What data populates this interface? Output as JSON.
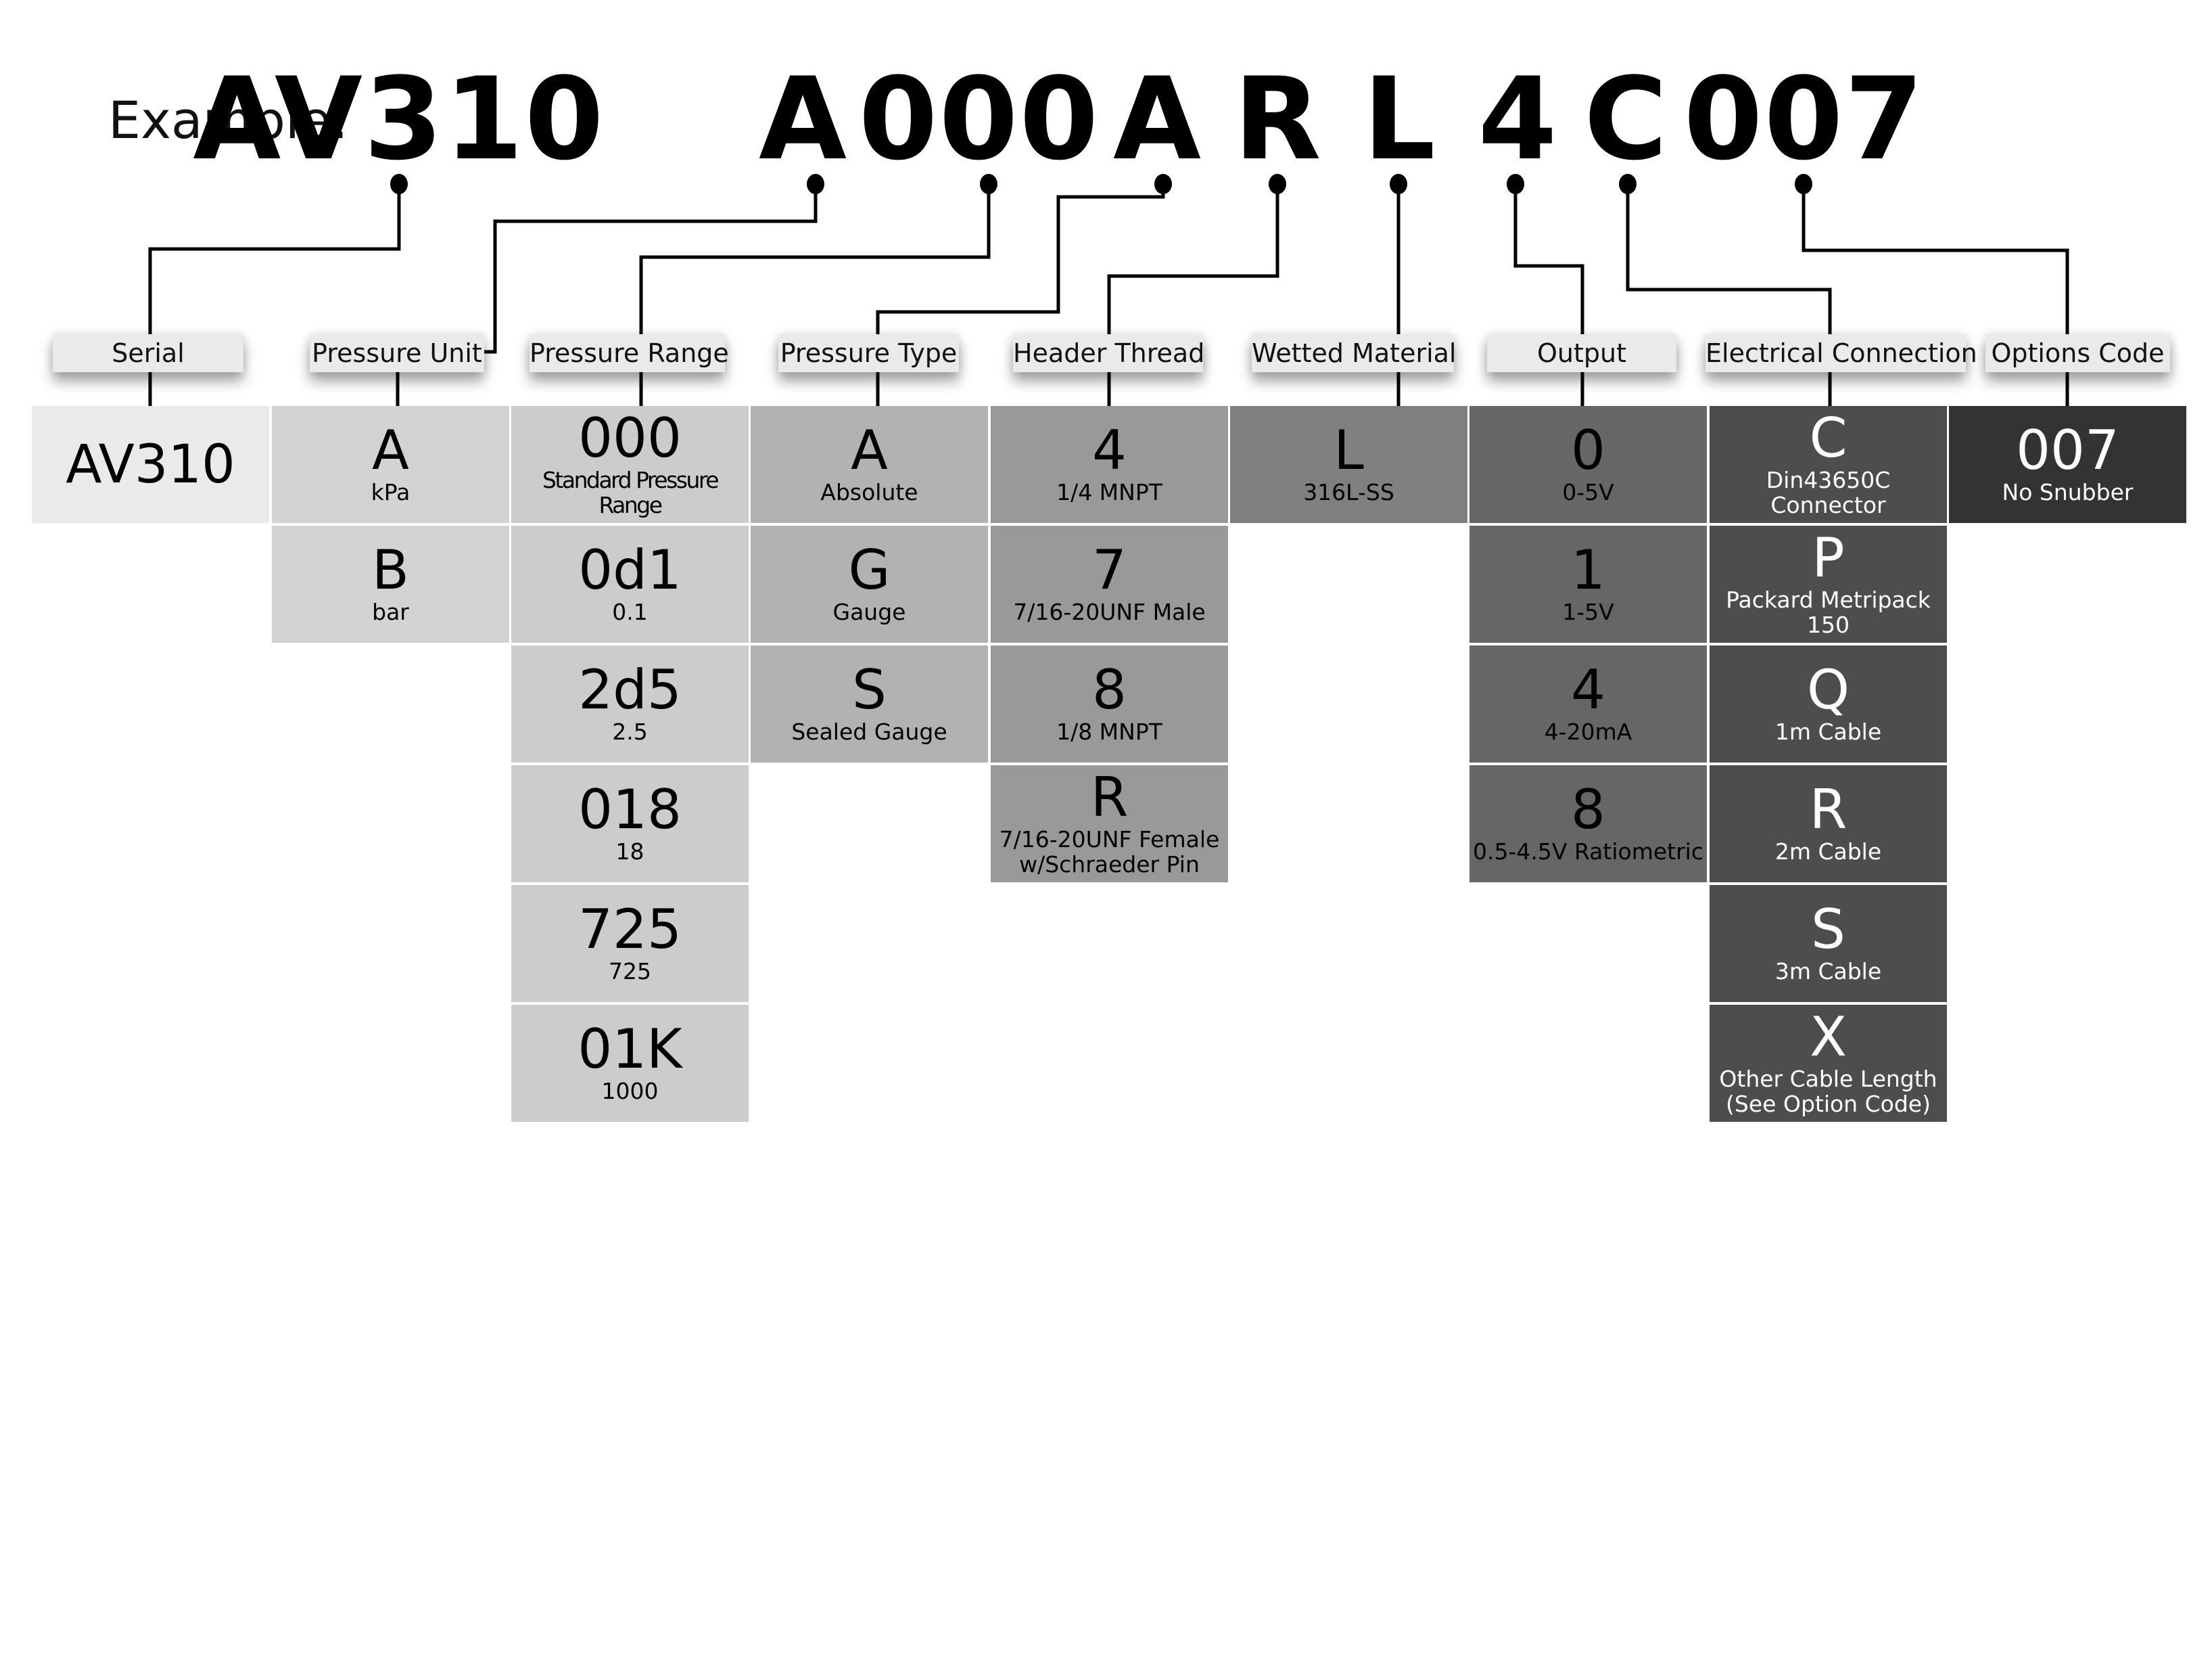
{
  "example_label": "Example:",
  "example_code": [
    "AV310",
    "A",
    "000",
    "A",
    "R",
    "L",
    "4",
    "C",
    "007"
  ],
  "categories": [
    {
      "label": "Serial",
      "fill": "#ebe9ea",
      "text_color": "#000000",
      "options": [
        {
          "code": "AV310",
          "desc": ""
        }
      ]
    },
    {
      "label": "Pressure Unit",
      "fill": "#d4d3d4",
      "text_color": "#000000",
      "options": [
        {
          "code": "A",
          "desc": "kPa"
        },
        {
          "code": "B",
          "desc": "bar"
        }
      ]
    },
    {
      "label": "Pressure Range",
      "fill": "#cccccc",
      "text_color": "#000000",
      "options": [
        {
          "code": "000",
          "desc": "Standard Pressure Range"
        },
        {
          "code": "0d1",
          "desc": "0.1"
        },
        {
          "code": "2d5",
          "desc": "2.5"
        },
        {
          "code": "018",
          "desc": "18"
        },
        {
          "code": "725",
          "desc": "725"
        },
        {
          "code": "01K",
          "desc": "1000"
        }
      ]
    },
    {
      "label": "Pressure Type",
      "fill": "#b2b2b2",
      "text_color": "#000000",
      "options": [
        {
          "code": "A",
          "desc": "Absolute"
        },
        {
          "code": "G",
          "desc": "Gauge"
        },
        {
          "code": "S",
          "desc": "Sealed Gauge"
        }
      ]
    },
    {
      "label": "Header Thread",
      "fill": "#999999",
      "text_color": "#000000",
      "options": [
        {
          "code": "4",
          "desc": "1/4 MNPT"
        },
        {
          "code": "7",
          "desc": "7/16-20UNF Male"
        },
        {
          "code": "8",
          "desc": "1/8 MNPT"
        },
        {
          "code": "R",
          "desc": "7/16-20UNF Female\nw/Schraeder Pin"
        }
      ]
    },
    {
      "label": "Wetted Material",
      "fill": "#808080",
      "text_color": "#000000",
      "options": [
        {
          "code": "L",
          "desc": "316L-SS"
        }
      ]
    },
    {
      "label": "Output",
      "fill": "#666666",
      "text_color": "#000000",
      "options": [
        {
          "code": "0",
          "desc": "0-5V"
        },
        {
          "code": "1",
          "desc": "1-5V"
        },
        {
          "code": "4",
          "desc": "4-20mA"
        },
        {
          "code": "8",
          "desc": "0.5-4.5V Ratiometric"
        }
      ]
    },
    {
      "label": "Electrical Connection",
      "fill": "#4d4d4d",
      "text_color": "#ffffff",
      "options": [
        {
          "code": "C",
          "desc": "Din43650C Connector"
        },
        {
          "code": "P",
          "desc": "Packard Metripack\n150"
        },
        {
          "code": "Q",
          "desc": "1m Cable"
        },
        {
          "code": "R",
          "desc": "2m Cable"
        },
        {
          "code": "S",
          "desc": "3m Cable"
        },
        {
          "code": "X",
          "desc": "Other Cable Length\n(See Option Code)"
        }
      ]
    },
    {
      "label": "Options Code",
      "fill": "#333333",
      "text_color": "#ffffff",
      "options": [
        {
          "code": "007",
          "desc": "No Snubber"
        }
      ]
    }
  ]
}
